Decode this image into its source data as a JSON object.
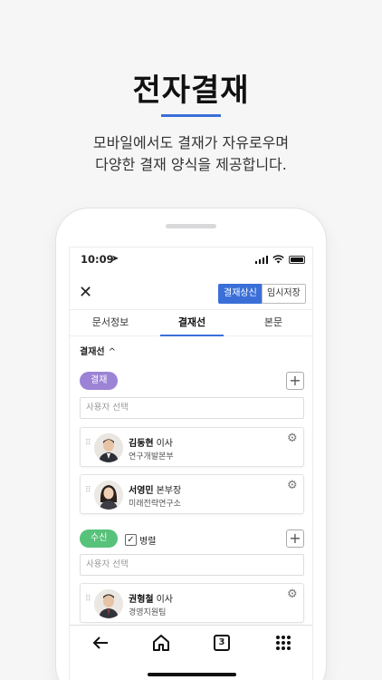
{
  "hero": {
    "title": "전자결재",
    "subtitle_line1": "모바일에서도 결재가 자유로우며",
    "subtitle_line2": "다양한 결재 양식을 제공합니다."
  },
  "status": {
    "time": "10:09"
  },
  "toolbar": {
    "approve_label": "결재상신",
    "save_label": "임시저장"
  },
  "tabs": [
    {
      "label": "문서정보",
      "active": false
    },
    {
      "label": "결재선",
      "active": true
    },
    {
      "label": "본문",
      "active": false
    }
  ],
  "section": {
    "title": "결재선",
    "toggle": "^"
  },
  "approval": {
    "chip": "결재",
    "placeholder": "사용자 선택",
    "people": [
      {
        "name": "김동현",
        "title": "이사",
        "dept": "연구개발본부"
      },
      {
        "name": "서영민",
        "title": "본부장",
        "dept": "미래전략연구소"
      }
    ]
  },
  "receive": {
    "chip": "수신",
    "checkbox_label": "병렬",
    "placeholder": "사용자 선택",
    "people": [
      {
        "name": "권형철",
        "title": "이사",
        "dept": "경영지원팀"
      }
    ]
  },
  "bottom_nav": {
    "tab_count": "3"
  },
  "colors": {
    "accent": "#3a6fd8",
    "approval_chip": "#9c83d6",
    "receive_chip": "#57c27a"
  }
}
